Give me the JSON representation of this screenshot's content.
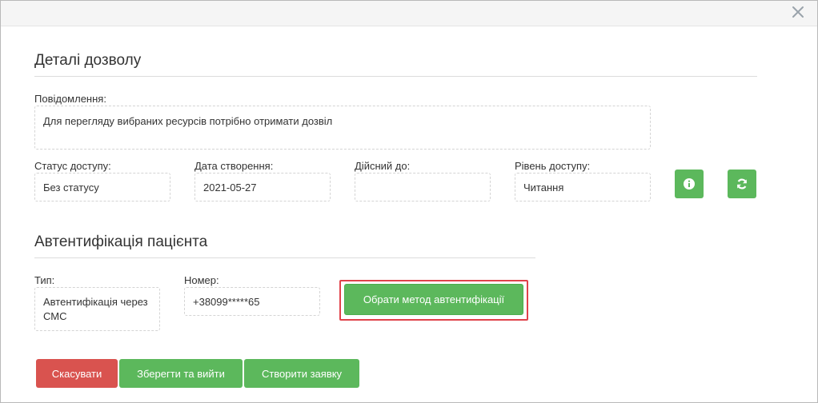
{
  "details": {
    "title": "Деталі дозволу",
    "message_label": "Повідомлення:",
    "message_value": "Для перегляду вибраних ресурсів потрібно отримати дозвіл",
    "status_label": "Статус доступу:",
    "status_value": "Без статусу",
    "created_label": "Дата створення:",
    "created_value": "2021-05-27",
    "valid_label": "Дійсний до:",
    "valid_value": "",
    "level_label": "Рівень доступу:",
    "level_value": "Читання"
  },
  "auth": {
    "title": "Автентифікація пацієнта",
    "type_label": "Тип:",
    "type_value": "Автентифікація через СМС",
    "number_label": "Номер:",
    "number_value": "+38099*****65",
    "choose_button": "Обрати метод автентифікації"
  },
  "footer": {
    "cancel": "Скасувати",
    "save_exit": "Зберегти та вийти",
    "create_request": "Створити заявку"
  },
  "icons": {
    "close": "close-icon",
    "info": "info-icon",
    "refresh": "refresh-icon"
  },
  "colors": {
    "success": "#5cb85c",
    "danger": "#d9534f",
    "highlight": "#e0424a"
  }
}
